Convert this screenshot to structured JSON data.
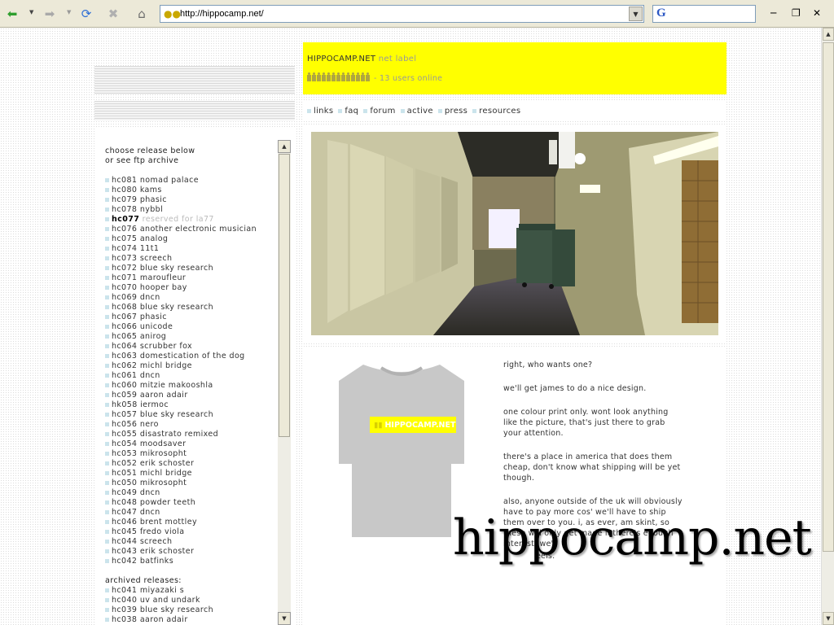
{
  "browser": {
    "url": "http://hippocamp.net/",
    "colors": {
      "chrome": "#ece9d8",
      "back": "#2e9e2e",
      "refresh": "#2f6fd6"
    }
  },
  "site": {
    "brand": "HIPPOCAMP.NET",
    "subtitle": "net label",
    "users_online": "- 13 users online",
    "user_icon_count": 13,
    "accent": "#ffff00",
    "bullet_color": "#cbe4ec"
  },
  "nav": [
    "links",
    "faq",
    "forum",
    "active",
    "press",
    "resources"
  ],
  "sidebar": {
    "heading1": "choose release below",
    "heading2": "or see ftp archive",
    "releases": [
      {
        "code": "hc081",
        "name": "nomad palace"
      },
      {
        "code": "hc080",
        "name": "kams"
      },
      {
        "code": "hc079",
        "name": "phasic"
      },
      {
        "code": "hc078",
        "name": "nybbl"
      },
      {
        "code": "hc077",
        "name": "reserved for la77",
        "dim": true
      },
      {
        "code": "hc076",
        "name": "another electronic musician"
      },
      {
        "code": "hc075",
        "name": "analog"
      },
      {
        "code": "hc074",
        "name": "11t1"
      },
      {
        "code": "hc073",
        "name": "screech"
      },
      {
        "code": "hc072",
        "name": "blue sky research"
      },
      {
        "code": "hc071",
        "name": "maroufleur"
      },
      {
        "code": "hc070",
        "name": "hooper bay"
      },
      {
        "code": "hc069",
        "name": "dncn"
      },
      {
        "code": "hc068",
        "name": "blue sky research"
      },
      {
        "code": "hc067",
        "name": "phasic"
      },
      {
        "code": "hc066",
        "name": "unicode"
      },
      {
        "code": "hc065",
        "name": "anirog"
      },
      {
        "code": "hc064",
        "name": "scrubber fox"
      },
      {
        "code": "hc063",
        "name": "domestication of the dog"
      },
      {
        "code": "hc062",
        "name": "michl bridge"
      },
      {
        "code": "hc061",
        "name": "dncn"
      },
      {
        "code": "hc060",
        "name": "mitzie makooshla"
      },
      {
        "code": "hc059",
        "name": "aaron adair"
      },
      {
        "code": "hk058",
        "name": "iermoc"
      },
      {
        "code": "hc057",
        "name": "blue sky research"
      },
      {
        "code": "hc056",
        "name": "nero"
      },
      {
        "code": "hc055",
        "name": "disastrato remixed"
      },
      {
        "code": "hc054",
        "name": "moodsaver"
      },
      {
        "code": "hc053",
        "name": "mikrosopht"
      },
      {
        "code": "hc052",
        "name": "erik schoster"
      },
      {
        "code": "hc051",
        "name": "michl bridge"
      },
      {
        "code": "hc050",
        "name": "mikrosopht"
      },
      {
        "code": "hc049",
        "name": "dncn"
      },
      {
        "code": "hc048",
        "name": "powder teeth"
      },
      {
        "code": "hc047",
        "name": "dncn"
      },
      {
        "code": "hc046",
        "name": "brent mottley"
      },
      {
        "code": "hc045",
        "name": "fredo viola"
      },
      {
        "code": "hc044",
        "name": "screech"
      },
      {
        "code": "hc043",
        "name": "erik schoster"
      },
      {
        "code": "hc042",
        "name": "batfinks"
      }
    ],
    "archived_heading": "archived releases:",
    "archived": [
      {
        "code": "hc041",
        "name": "miyazaki s"
      },
      {
        "code": "hc040",
        "name": "uv and undark"
      },
      {
        "code": "hc039",
        "name": "blue sky research"
      },
      {
        "code": "hc038",
        "name": "aaron adair"
      }
    ]
  },
  "post": {
    "shirt_label": "HIPPOCAMP.NET",
    "paragraphs": [
      "right, who wants one?",
      "we'll get james to do a nice design.",
      "one colour print only. wont look anything like the picture, that's just there to grab your attention.",
      "there's a place in america that does them cheap, don't know what shipping will be yet though.",
      "also, anyone outside of the uk will obviously have to pay more cos' we'll have to ship them over to you. i, as ever, am skint, so these will only get made if there's enough interest. we'll"
    ],
    "fragment": "eels."
  },
  "watermark": "hippocamp.net"
}
